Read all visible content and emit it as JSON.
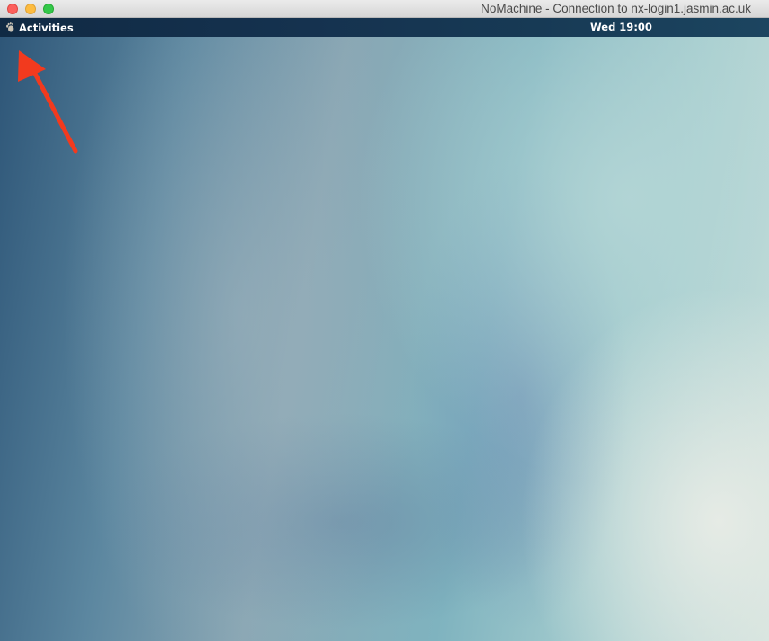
{
  "window": {
    "title": "NoMachine - Connection to nx-login1.jasmin.ac.uk"
  },
  "topbar": {
    "activities_label": "Activities",
    "activities_icon": "gnome-foot-icon",
    "clock": "Wed 19:00"
  },
  "annotation": {
    "icon": "red-arrow-icon",
    "color": "#f23a1e"
  },
  "colors": {
    "topbar_bg": "#132f4b",
    "traffic_close": "#fc605c",
    "traffic_minimize": "#fdbc40",
    "traffic_zoom": "#34c84a"
  }
}
